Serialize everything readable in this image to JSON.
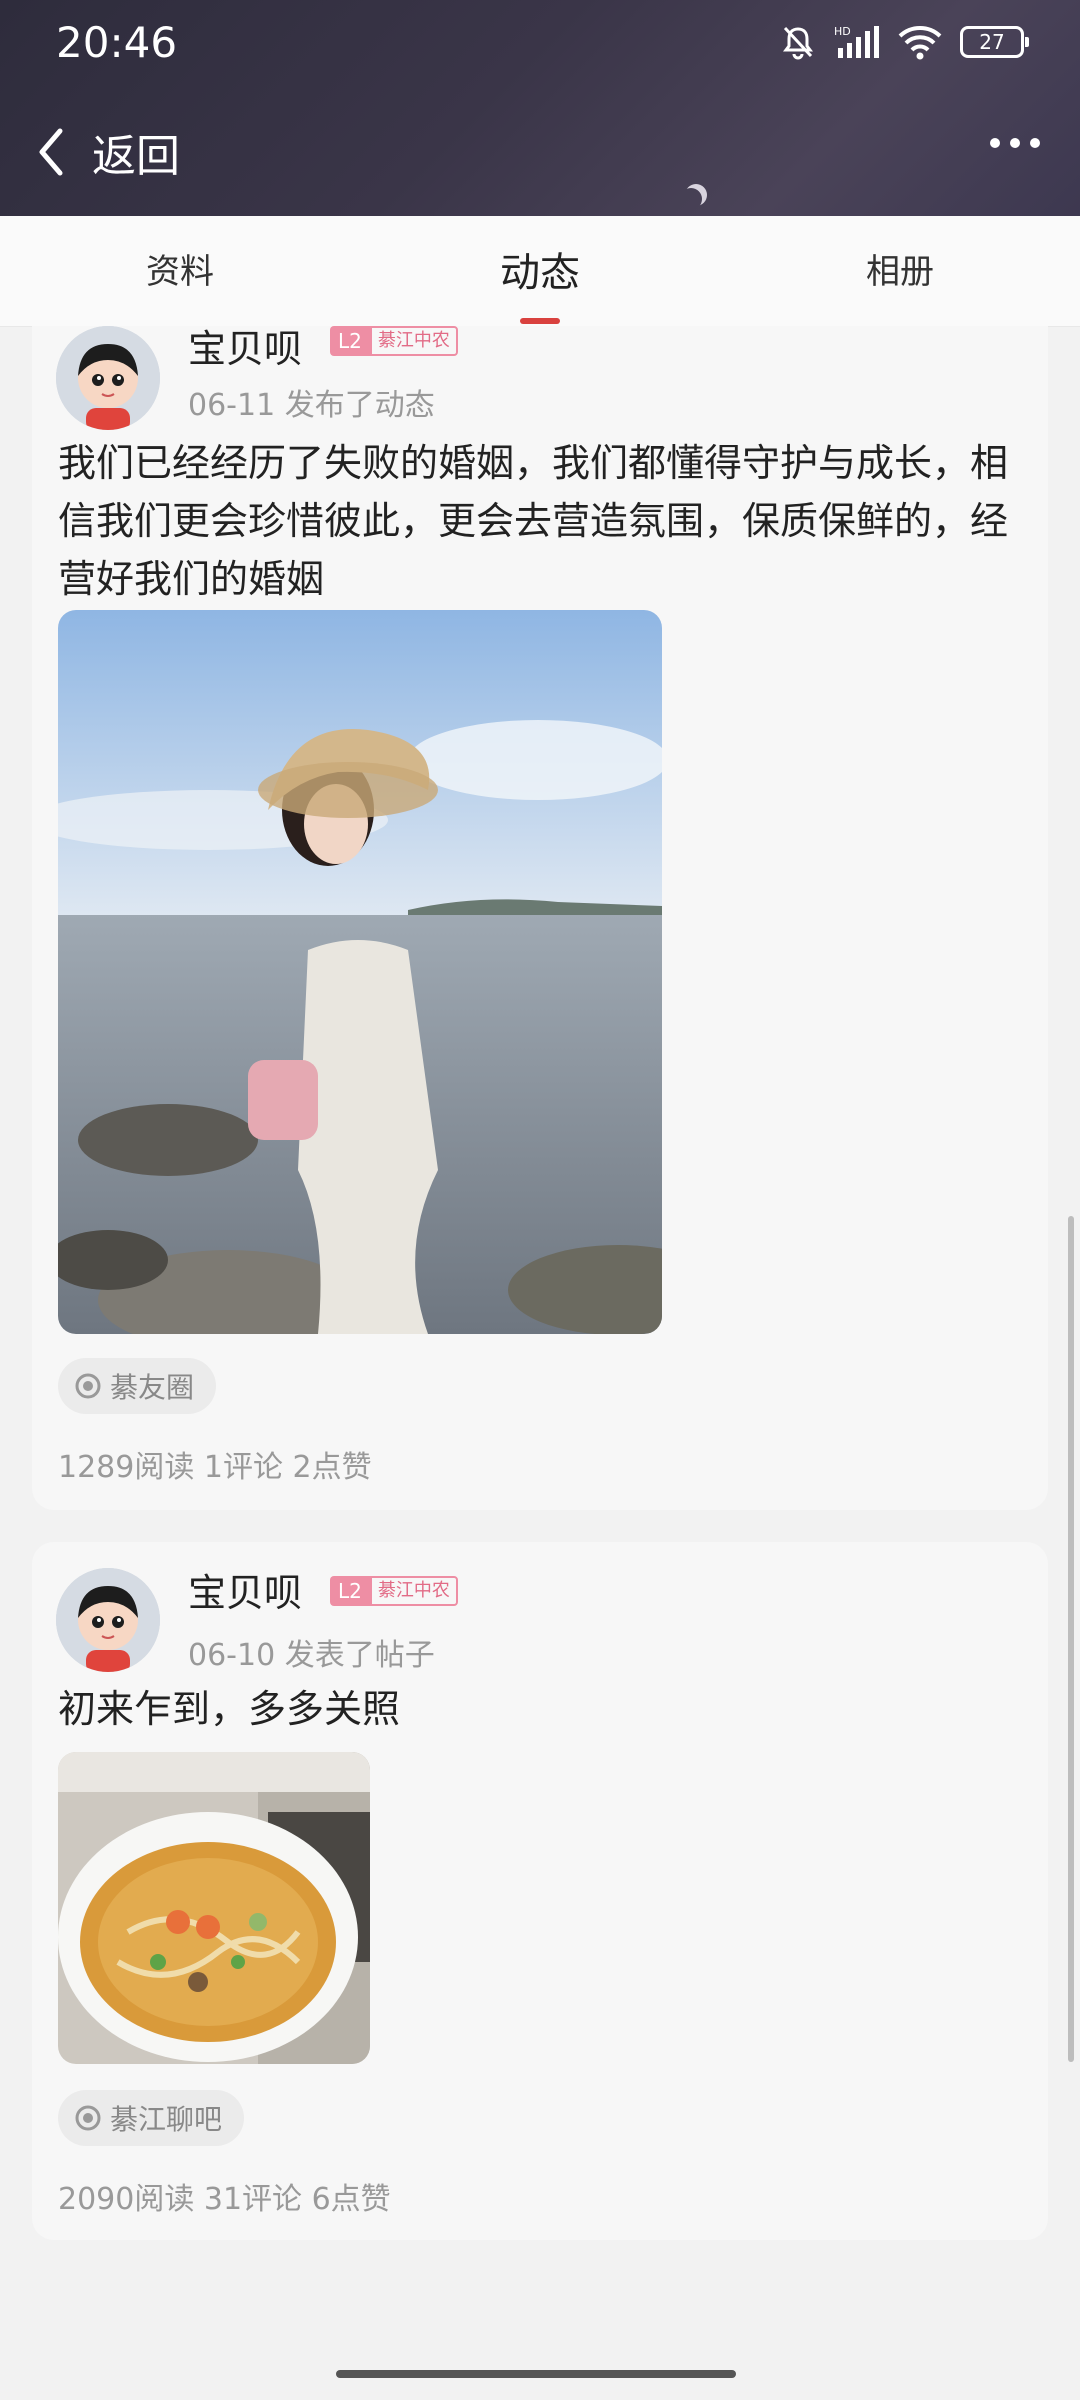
{
  "status_bar": {
    "time": "20:46",
    "battery": "27"
  },
  "header": {
    "back_label": "返回"
  },
  "tabs": [
    {
      "label": "资料",
      "active": false
    },
    {
      "label": "动态",
      "active": true
    },
    {
      "label": "相册",
      "active": false
    }
  ],
  "posts": [
    {
      "username": "宝贝呗",
      "level": "L2",
      "region_badge": "綦江中农",
      "meta": "06-11 发布了动态",
      "text": "我们已经经历了失败的婚姻，我们都懂得守护与成长，相信我们更会珍惜彼此，更会去营造氛围，保质保鲜的，经营好我们的婚姻",
      "tag": "綦友圈",
      "stats": "1289阅读 1评论 2点赞"
    },
    {
      "username": "宝贝呗",
      "level": "L2",
      "region_badge": "綦江中农",
      "meta": "06-10 发表了帖子",
      "text": "初来乍到，多多关照",
      "tag": "綦江聊吧",
      "stats": "2090阅读 31评论 6点赞"
    }
  ],
  "colors": {
    "accent": "#d9413e",
    "badge": "#ee8ea4"
  }
}
